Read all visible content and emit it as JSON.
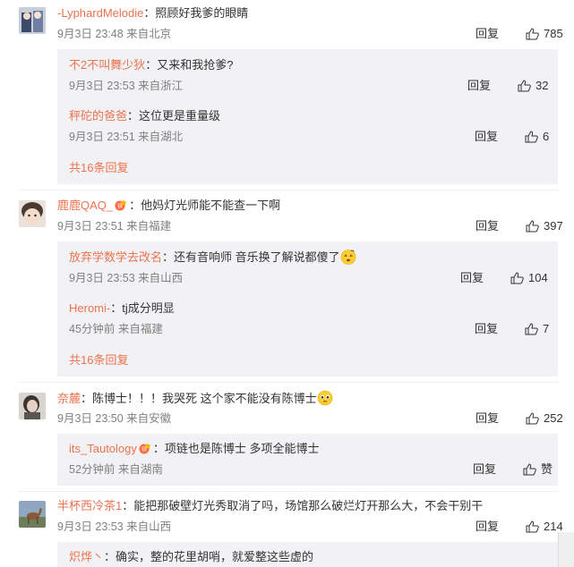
{
  "comments": [
    {
      "user": "-LyphardMelodie",
      "text": "：照顾好我爹的眼睛",
      "date": "9月3日 23:48",
      "location": "来自北京",
      "reply_label": "回复",
      "likes": "785",
      "replies": [
        {
          "user": "不2不叫舞少狄",
          "text": "：又来和我抢爹?",
          "date": "9月3日 23:53",
          "location": "来自浙江",
          "reply_label": "回复",
          "likes": "32"
        },
        {
          "user": "秤砣的爸爸",
          "text": "：这位更是重量级",
          "date": "9月3日 23:51",
          "location": "来自湖北",
          "reply_label": "回复",
          "likes": "6"
        }
      ],
      "more": "共16条回复"
    },
    {
      "user": "鹿鹿QAQ_",
      "text": "：他妈灯光师能不能查一下啊",
      "date": "9月3日 23:51",
      "location": "来自福建",
      "reply_label": "回复",
      "likes": "397",
      "replies": [
        {
          "user": "放弃学数学去改名",
          "text": "：还有音响师 音乐换了解说都傻了",
          "date": "9月3日 23:53",
          "location": "来自山西",
          "reply_label": "回复",
          "likes": "104"
        },
        {
          "user": "Heromi-",
          "text": "：tj成分明显",
          "date": "45分钟前",
          "location": "来自福建",
          "reply_label": "回复",
          "likes": "7"
        }
      ],
      "more": "共16条回复"
    },
    {
      "user": "奈麓",
      "text": "：陈博士！！！我哭死 这个家不能没有陈博士",
      "date": "9月3日 23:50",
      "location": "来自安徽",
      "reply_label": "回复",
      "likes": "252",
      "replies": [
        {
          "user": "its_Tautology",
          "text": "：项链也是陈博士 多项全能博士",
          "date": "52分钟前",
          "location": "来自湖南",
          "reply_label": "回复",
          "likes": "赞"
        }
      ]
    },
    {
      "user": "半杯西冷茶1",
      "text": "：能把那破壁灯光秀取消了吗，场馆那么破烂灯开那么大，不会干别干",
      "date": "9月3日 23:53",
      "location": "来自山西",
      "reply_label": "回复",
      "likes": "214",
      "replies": [
        {
          "user": "炽烨丶",
          "text": "：确实，整的花里胡哨，就爱整这些虚的"
        }
      ]
    }
  ],
  "colors": {
    "username": "#eb7350",
    "meta": "#808080",
    "reply_bg": "#f2f2f5"
  }
}
